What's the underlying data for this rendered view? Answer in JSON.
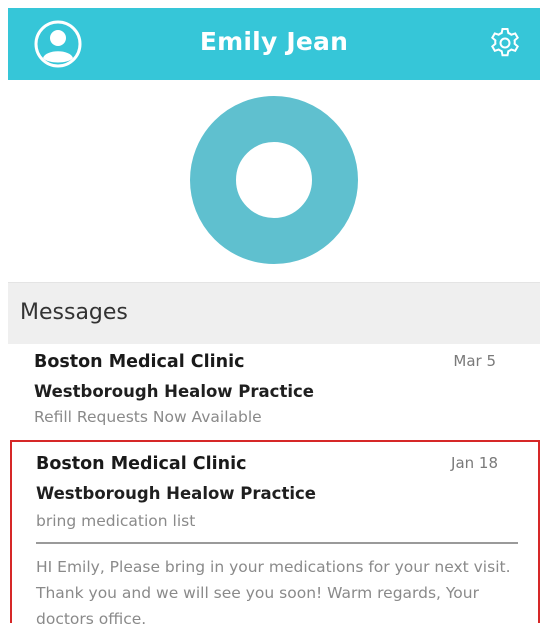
{
  "header": {
    "title": "Emily Jean",
    "bg_color": "#36c6d8",
    "avatar_icon": "user-avatar-icon",
    "settings_icon": "gear-icon"
  },
  "donut": {
    "color": "#5fc0cf"
  },
  "messages_section": {
    "title": "Messages",
    "items": [
      {
        "sender": "Boston Medical Clinic",
        "practice": "Westborough Healow Practice",
        "subject": "Refill Requests Now Available",
        "date": "Mar 5"
      },
      {
        "sender": "Boston Medical Clinic",
        "practice": "Westborough Healow Practice",
        "subject": "bring medication list",
        "date": "Jan 18",
        "body": "HI Emily, Please bring in your medications for your next visit. Thank you and we will see you soon! Warm regards, Your doctors office.",
        "highlight_color": "#d62828"
      }
    ]
  }
}
